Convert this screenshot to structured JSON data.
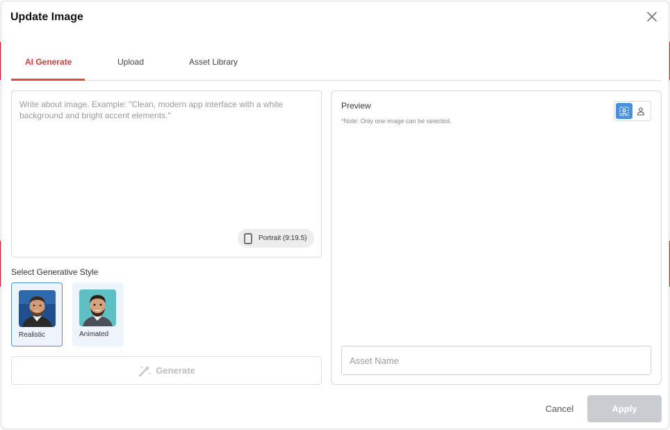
{
  "dialog": {
    "title": "Update Image",
    "close_icon": "close-icon"
  },
  "tabs": [
    {
      "label": "AI Generate",
      "active": true
    },
    {
      "label": "Upload",
      "active": false
    },
    {
      "label": "Asset Library",
      "active": false
    }
  ],
  "prompt": {
    "placeholder": "Write about image. Example: \"Clean, modern app interface with a white background and bright accent elements.\"",
    "value": "",
    "aspect_ratio": "Portrait (9:19.5)",
    "aspect_icon": "phone-portrait-icon"
  },
  "styles": {
    "label": "Select Generative Style",
    "options": [
      {
        "label": "Realistic",
        "selected": true,
        "icon": "realistic-portrait-thumbnail"
      },
      {
        "label": "Animated",
        "selected": false,
        "icon": "animated-portrait-thumbnail"
      }
    ]
  },
  "generate": {
    "label": "Generate",
    "icon": "magic-wand-icon",
    "enabled": false
  },
  "preview": {
    "title": "Preview",
    "note": "*Note: Only one image can be selected.",
    "toggle": [
      {
        "icon": "image-view-icon",
        "active": true
      },
      {
        "icon": "person-view-icon",
        "active": false
      }
    ]
  },
  "asset_name": {
    "placeholder": "Asset Name",
    "value": ""
  },
  "footer": {
    "cancel_label": "Cancel",
    "apply_label": "Apply",
    "apply_enabled": false
  },
  "colors": {
    "accent_red": "#e04646",
    "active_tab_text": "#d23a3a",
    "selected_blue": "#4a90d9",
    "disabled_button": "#c9cdd2"
  }
}
